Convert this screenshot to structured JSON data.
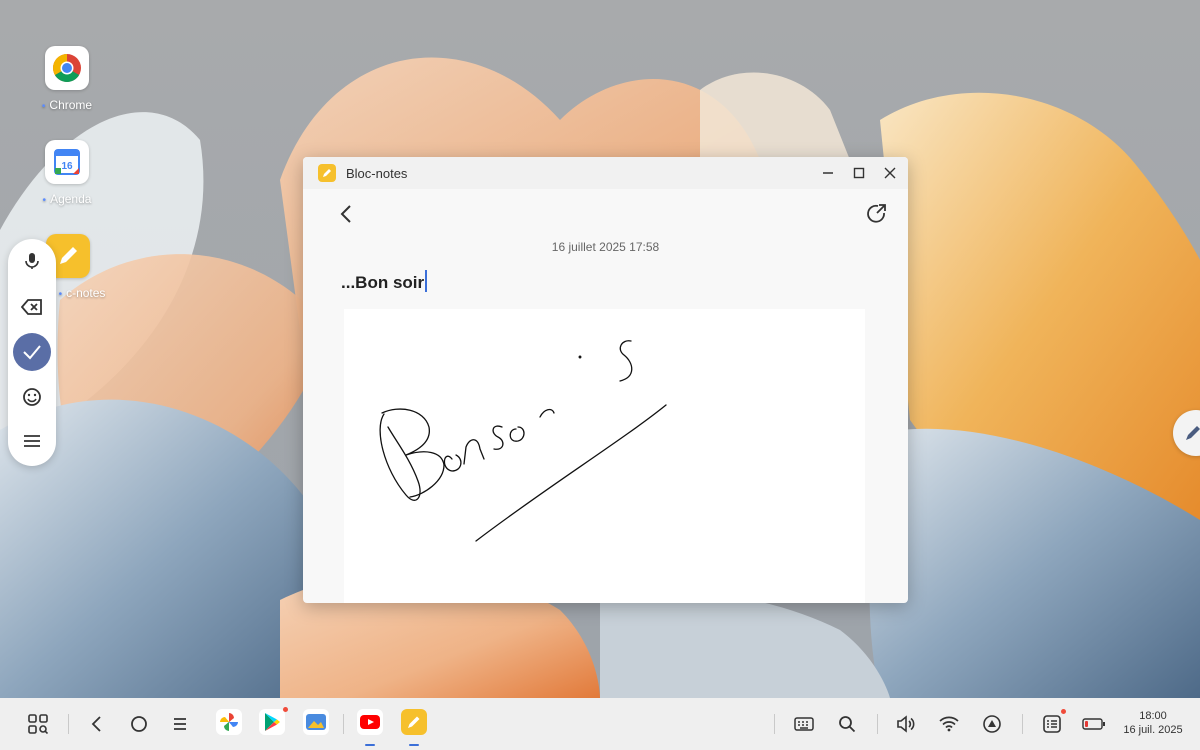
{
  "desktop": {
    "icons": [
      {
        "label": "Chrome",
        "icon": "chrome-icon"
      },
      {
        "label": "Agenda",
        "icon": "calendar-icon",
        "badge": "16"
      },
      {
        "label": "c-notes",
        "icon": "notes-icon"
      }
    ]
  },
  "floating_toolbar": {
    "buttons": [
      "microphone-icon",
      "backspace-icon",
      "check-icon",
      "emoji-icon",
      "menu-icon"
    ]
  },
  "window": {
    "title": "Bloc-notes",
    "note": {
      "date": "16 juillet 2025 17:58",
      "title": "...Bon soir",
      "handwriting": "Bonsoir"
    }
  },
  "taskbar": {
    "clock_time": "18:00",
    "clock_date": "16 juil. 2025",
    "accent": "#3b6fd8"
  },
  "colors": {
    "notes_yellow": "#f6c02c",
    "check_blue": "#5a6ea6"
  }
}
